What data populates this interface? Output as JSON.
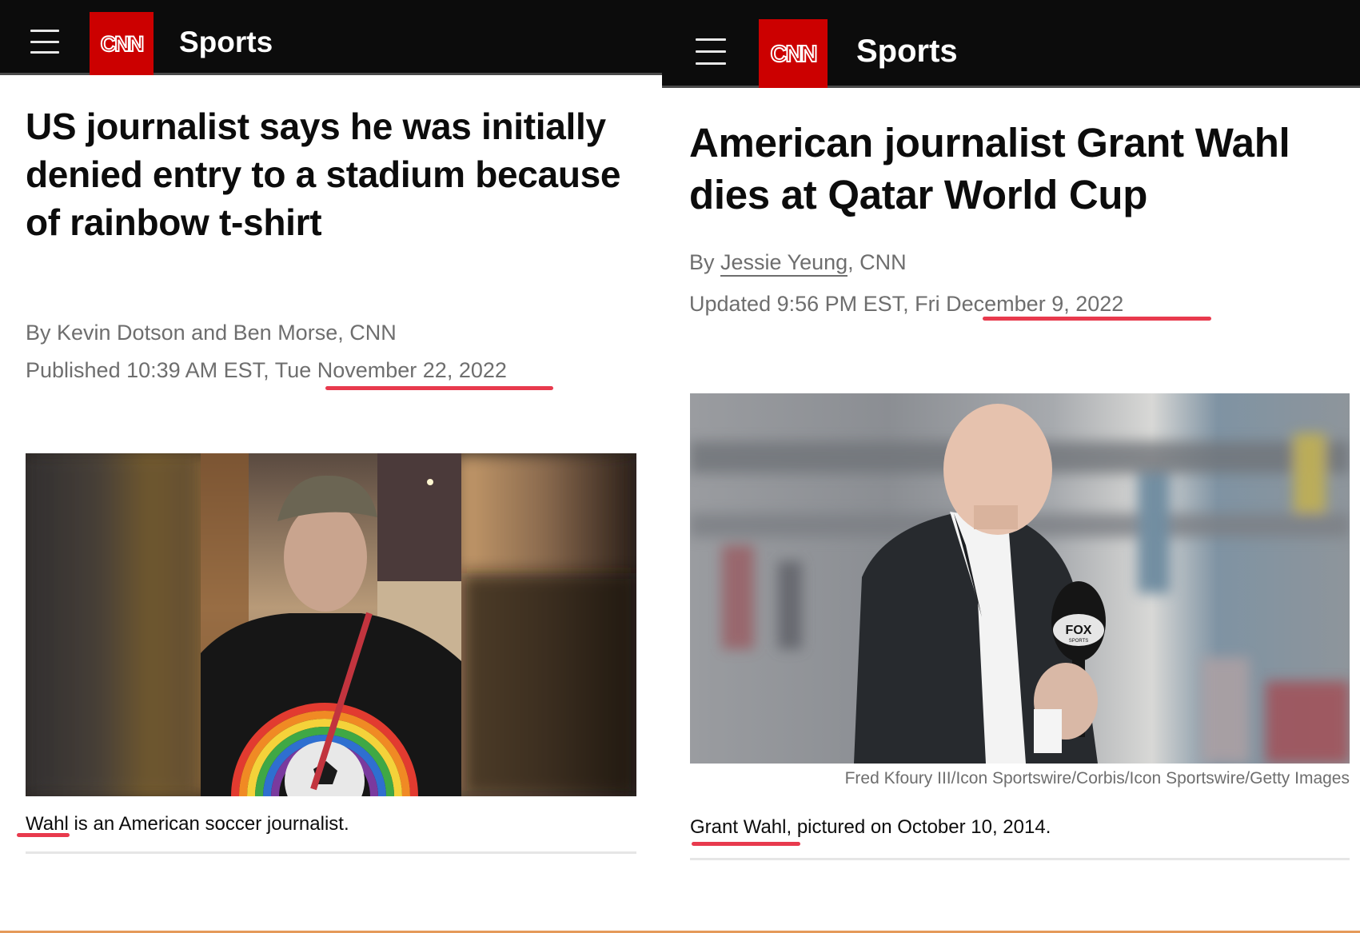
{
  "left_article": {
    "header": {
      "menu_icon": "hamburger-menu-icon",
      "logo_text": "CNN",
      "section": "Sports"
    },
    "headline": "US journalist says he was initially denied entry to a stadium because of rainbow t-shirt",
    "byline": "By Kevin Dotson and Ben Morse, CNN",
    "published_prefix": "Published 10:39 AM EST, Tue ",
    "published_date": "November 22, 2022",
    "image_alt": "Man in cap wearing a black t-shirt with a rainbow and soccer ball design",
    "caption_name": "Wahl",
    "caption_rest": " is an American soccer journalist."
  },
  "right_article": {
    "header": {
      "menu_icon": "hamburger-menu-icon",
      "logo_text": "CNN",
      "section": "Sports"
    },
    "headline": "American journalist Grant Wahl dies at Qatar World Cup",
    "byline_prefix": "By ",
    "author": "Jessie Yeung",
    "byline_suffix": ", CNN",
    "updated_prefix": "Updated 9:56 PM EST, Fri ",
    "updated_date": "December 9, 2022",
    "image_alt": "Bald man in dark suit holding a FOX Sports microphone",
    "mic_label": "FOX",
    "mic_sublabel": "SPORTS",
    "image_credit": "Fred Kfoury III/Icon Sportswire/Corbis/Icon Sportswire/Getty Images",
    "caption_name": "Grant Wahl",
    "caption_rest": ", pictured on October 10, 2014."
  },
  "colors": {
    "header_bg": "#0c0c0c",
    "cnn_red": "#cc0000",
    "annotation_red": "#e83a4d",
    "meta_gray": "#6e6e6e"
  }
}
